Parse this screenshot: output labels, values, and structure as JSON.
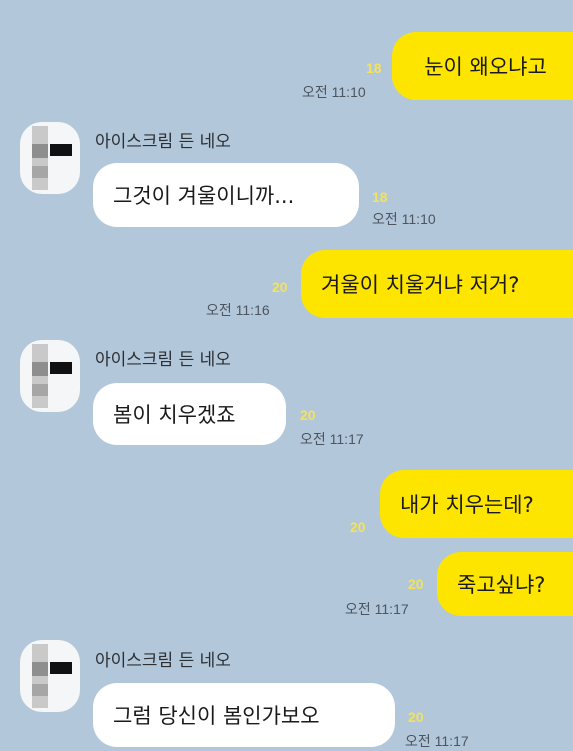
{
  "messages": [
    {
      "text": "눈이 왜오냐고",
      "read_count": "18",
      "time": "오전 11:10"
    },
    {
      "sender": "아이스크림 든 네오",
      "text": "그것이 겨울이니까...",
      "read_count": "18",
      "time": "오전 11:10"
    },
    {
      "text": "겨울이 치울거냐 저거?",
      "read_count": "20",
      "time": "오전 11:16"
    },
    {
      "sender": "아이스크림 든 네오",
      "text": "봄이 치우겠죠",
      "read_count": "20",
      "time": "오전 11:17"
    },
    {
      "text": "내가 치우는데?",
      "read_count": "20",
      "time": ""
    },
    {
      "text": "죽고싶냐?",
      "read_count": "20",
      "time": "오전 11:17"
    },
    {
      "sender": "아이스크림 든 네오",
      "text": "그럼 당신이 봄인가보오",
      "read_count": "20",
      "time": "오전 11:17"
    }
  ],
  "colors": {
    "background": "#b2c7da",
    "my_bubble": "#fee500",
    "their_bubble": "#ffffff",
    "read_count": "#f3e25a"
  }
}
